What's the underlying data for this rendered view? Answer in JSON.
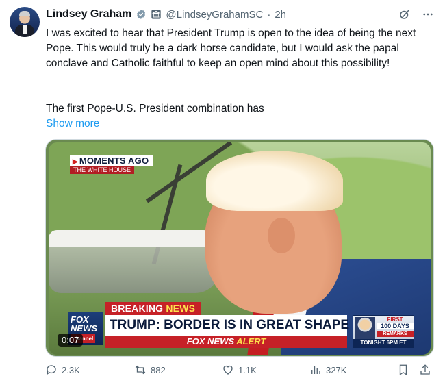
{
  "post": {
    "author_name": "Lindsey Graham",
    "author_handle": "@LindseyGrahamSC",
    "time_sep": "·",
    "time_ago": "2h",
    "paragraph1": "I was excited to hear that President Trump is open to the idea of being the next Pope. This would truly be a dark horse candidate, but I would ask the papal conclave and Catholic faithful to keep an open mind about this possibility!",
    "paragraph2": "The first Pope-U.S. President combination has",
    "show_more": "Show more"
  },
  "video": {
    "duration": "0:07",
    "chyron_moments": "MOMENTS AGO",
    "chyron_location": "THE WHITE HOUSE",
    "breaking": "BREAKING",
    "breaking_news": "NEWS",
    "headline": "TRUMP: BORDER IS IN GREAT SHAPE",
    "subbar_network": "FOX NEWS",
    "subbar_alert": "ALERT",
    "logo_line1": "FOX",
    "logo_line2": "NEWS",
    "logo_channel": "channel",
    "promo_first": "FIRST",
    "promo_days": "100 DAYS",
    "promo_remarks": "REMARKS",
    "promo_tonight": "TONIGHT 6PM ET"
  },
  "actions": {
    "replies": "2.3K",
    "reposts": "882",
    "likes": "1.1K",
    "views": "327K"
  },
  "colors": {
    "link": "#1d9bf0",
    "muted": "#536471",
    "verified_badge": "#829aab",
    "fox_red": "#c62127"
  }
}
